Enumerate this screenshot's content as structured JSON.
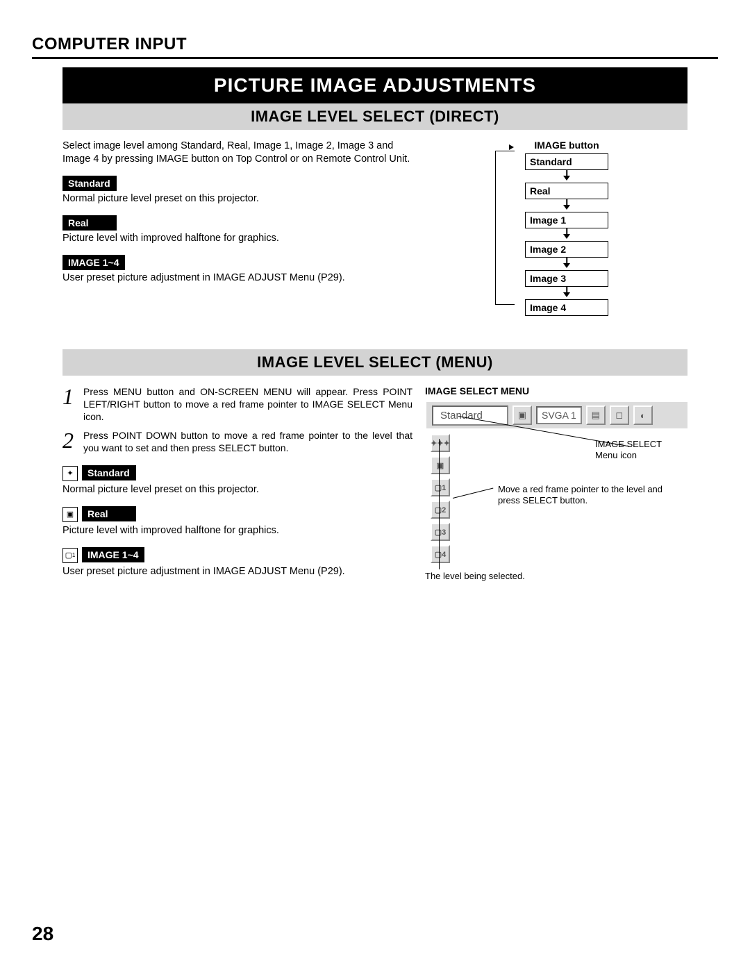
{
  "header": "COMPUTER INPUT",
  "title": "PICTURE IMAGE ADJUSTMENTS",
  "sub1": "IMAGE LEVEL SELECT (DIRECT)",
  "direct": {
    "intro": "Select image level among Standard, Real, Image 1, Image 2, Image 3 and Image 4 by pressing IMAGE button on Top Control or on Remote Control Unit.",
    "std_label": "Standard",
    "std_desc": "Normal picture level preset on this projector.",
    "real_label": "Real",
    "real_desc": "Picture level with improved halftone for graphics.",
    "img_label": "IMAGE 1~4",
    "img_desc": "User preset picture adjustment in IMAGE ADJUST Menu (P29)."
  },
  "flow": {
    "title": "IMAGE button",
    "items": [
      "Standard",
      "Real",
      "Image 1",
      "Image 2",
      "Image 3",
      "Image 4"
    ]
  },
  "sub2": "IMAGE LEVEL SELECT (MENU)",
  "steps": {
    "n1": "1",
    "t1": "Press MENU button and ON-SCREEN MENU will appear. Press POINT LEFT/RIGHT button to move a red frame pointer to IMAGE SELECT Menu icon.",
    "n2": "2",
    "t2": "Press POINT DOWN button to move a red frame pointer to the level that you want to set and then press SELECT button."
  },
  "menu": {
    "std_label": "Standard",
    "std_desc": "Normal picture level preset on this projector.",
    "real_label": "Real",
    "real_desc": "Picture level with improved halftone for graphics.",
    "img_label": "IMAGE 1~4",
    "img_desc": "User preset picture adjustment in IMAGE ADJUST Menu (P29)."
  },
  "shot": {
    "title": "IMAGE SELECT MENU",
    "bar_text": "Standard",
    "badge": "SVGA 1",
    "callout1a": "IMAGE SELECT",
    "callout1b": "Menu icon",
    "callout2": "Move a red frame pointer to the level and press SELECT button.",
    "callout3": "The level being selected.",
    "side_labels": [
      "✦✦✦",
      "▣",
      "▢1",
      "▢2",
      "▢3",
      "▢4"
    ]
  },
  "page_number": "28"
}
